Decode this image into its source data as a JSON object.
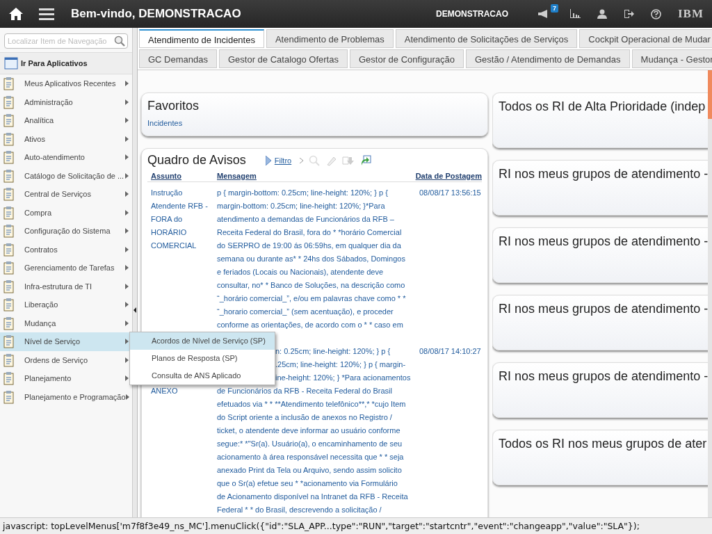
{
  "header": {
    "welcome": "Bem-vindo, DEMONSTRACAO",
    "user": "DEMONSTRACAO",
    "notifications": "7",
    "logo": "IBM"
  },
  "sidebar": {
    "search": {
      "placeholder": "Localizar Item de Navegação"
    },
    "heading": "Ir Para Aplicativos",
    "items": [
      {
        "label": "Meus Aplicativos Recentes",
        "selected": false
      },
      {
        "label": "Administração",
        "selected": false
      },
      {
        "label": "Analítica",
        "selected": false
      },
      {
        "label": "Ativos",
        "selected": false
      },
      {
        "label": "Auto-atendimento",
        "selected": false
      },
      {
        "label": "Catálogo de Solicitação de ...",
        "selected": false
      },
      {
        "label": "Central de Serviços",
        "selected": false
      },
      {
        "label": "Compra",
        "selected": false
      },
      {
        "label": "Configuração do Sistema",
        "selected": false
      },
      {
        "label": "Contratos",
        "selected": false
      },
      {
        "label": "Gerenciamento de Tarefas",
        "selected": false
      },
      {
        "label": "Infra-estrutura de TI",
        "selected": false
      },
      {
        "label": "Liberação",
        "selected": false
      },
      {
        "label": "Mudança",
        "selected": false
      },
      {
        "label": "Nível de Serviço",
        "selected": true
      },
      {
        "label": "Ordens de Serviço",
        "selected": false
      },
      {
        "label": "Planejamento",
        "selected": false
      },
      {
        "label": "Planejamento e Programação",
        "selected": false
      }
    ]
  },
  "submenu": [
    {
      "label": "Acordos de Nível de Serviço (SP)",
      "selected": true
    },
    {
      "label": "Planos de Resposta (SP)",
      "selected": false
    },
    {
      "label": "Consulta de ANS Aplicado",
      "selected": false
    }
  ],
  "tabs": [
    [
      {
        "label": "Atendimento de Incidentes",
        "selected": true
      },
      {
        "label": "Atendimento de Problemas",
        "selected": false
      },
      {
        "label": "Atendimento de Solicitações de Serviços",
        "selected": false
      },
      {
        "label": "Cockpit Operacional de Mudar",
        "selected": false
      }
    ],
    [
      {
        "label": "GC Demandas",
        "selected": false
      },
      {
        "label": "Gestor de Catalogo Ofertas",
        "selected": false
      },
      {
        "label": "Gestor de Configuração",
        "selected": false
      },
      {
        "label": "Gestão / Atendimento de Demandas",
        "selected": false
      },
      {
        "label": "Mudança - Gestor",
        "selected": false
      }
    ]
  ],
  "favorites": {
    "title": "Favoritos",
    "links": [
      "Incidentes"
    ]
  },
  "bulletin": {
    "title": "Quadro de Avisos",
    "filter": "Filtro",
    "columns": [
      "Assunto",
      "Mensagem",
      "Data de Postagem"
    ],
    "rows": [
      {
        "covered": false,
        "subject": [
          "Instrução",
          "Atendente RFB -",
          "FORA do",
          "HORÁRIO",
          "COMERCIAL"
        ],
        "message_fragments": [],
        "message": [
          "p { margin-bottom: 0.25cm; line-height: 120%; } p {",
          "margin-bottom: 0.25cm; line-height: 120%; }*Para",
          "atendimento a demandas de Funcionários da RFB –",
          "Receita Federal do Brasil, fora do * *horário Comercial",
          "do SERPRO de 19:00 ás 06:59hs, em qualquer dia da",
          "semana ou durante as* * 24hs dos Sábados, Domingos",
          "e feriados (Locais ou Nacionais), atendente deve",
          "consultar, no* * Banco de Soluções, na descrição como",
          "“_horário comercial_”, e/ou em palavras chave como * *",
          "“_horario comercial_” (sem acentuação), e proceder",
          "conforme as orientações, de acordo com o * * caso em"
        ],
        "date": "08/08/17 13:56:15"
      },
      {
        "covered": true,
        "subject": [
          "ANEXO"
        ],
        "message_fragments": [
          "n: 0.25cm; line-height: 120%; } p {",
          ".25cm; line-height: 120%; } p { margin-",
          "ine-height: 120%; } *Para acionamentos"
        ],
        "message": [
          "de Funcionários da RFB - Receita Federal do Brasil",
          "efetuados via * * **Atendimento telefônico**,* *cujo Item",
          "do Script oriente a inclusão de anexos no Registro /",
          "ticket, o atendente deve informar ao usuário conforme",
          "segue:* *\"Sr(a). Usuário(a), o encaminhamento de seu",
          "acionamento à área responsável necessita que * * seja",
          "anexado Print da Tela ou Arquivo, sendo assim solicito",
          "que o Sr(a) efetue seu *   *acionamento via Formulário",
          "de Acionamento disponível na Intranet da RFB - Receita",
          "Federal * * do Brasil, descrevendo a solicitação /"
        ],
        "date": "08/08/17 14:10:27"
      }
    ]
  },
  "portlets": [
    "Todos os RI de Alta Prioridade (indep",
    "RI nos meus grupos de atendimento -",
    "RI nos meus grupos de atendimento -",
    "RI nos meus grupos de atendimento -",
    "RI nos meus grupos de atendimento -",
    "Todos os RI nos meus grupos de ater"
  ],
  "status_bar": "javascript: topLevelMenus['m7f8f3e49_ns_MC'].menuClick({\"id\":\"SLA_APP...type\":\"RUN\",\"target\":\"startcntr\",\"event\":\"changeapp\",\"value\":\"SLA\"});"
}
